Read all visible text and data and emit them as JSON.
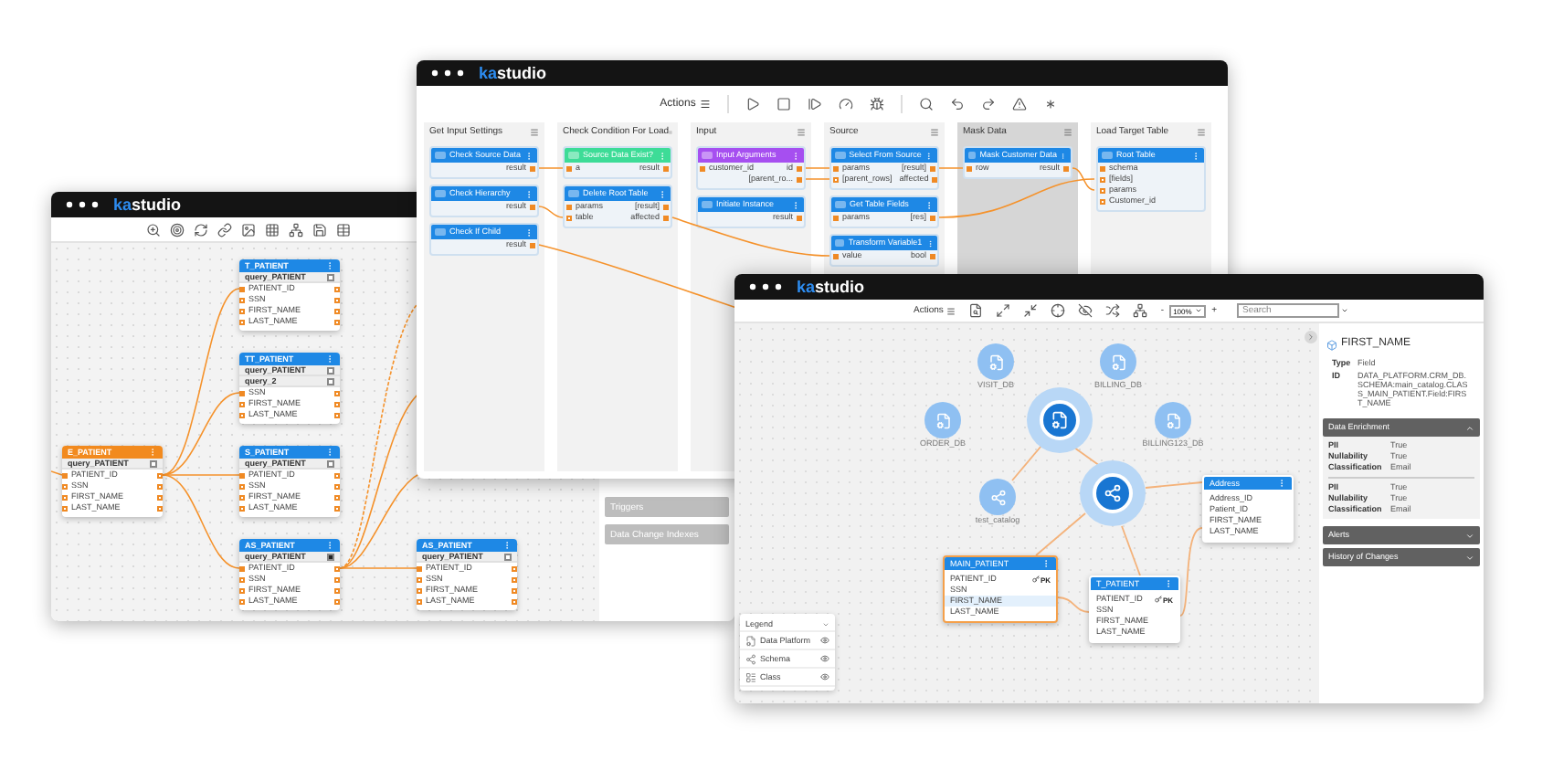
{
  "left_window": {
    "logo": {
      "accent": "ka",
      "rest": "studio"
    },
    "tables": [
      {
        "name": "T_PATIENT",
        "selected": false,
        "queries": [
          {
            "label": "query_PATIENT",
            "checked": false
          }
        ],
        "fields": [
          "PATIENT_ID",
          "SSN",
          "FIRST_NAME",
          "LAST_NAME"
        ]
      },
      {
        "name": "TT_PATIENT",
        "selected": false,
        "queries": [
          {
            "label": "query_PATIENT",
            "checked": false
          },
          {
            "label": "query_2",
            "checked": false
          }
        ],
        "fields": [
          "SSN",
          "FIRST_NAME",
          "LAST_NAME"
        ]
      },
      {
        "name": "S_PATIENT",
        "selected": false,
        "queries": [
          {
            "label": "query_PATIENT",
            "checked": false
          }
        ],
        "fields": [
          "PATIENT_ID",
          "SSN",
          "FIRST_NAME",
          "LAST_NAME"
        ]
      },
      {
        "name": "AS_PATIENT",
        "selected": false,
        "queries": [
          {
            "label": "query_PATIENT",
            "checked": true
          }
        ],
        "fields": [
          "PATIENT_ID",
          "SSN",
          "FIRST_NAME",
          "LAST_NAME"
        ]
      },
      {
        "name": "E_PATIENT",
        "selected": true,
        "queries": [
          {
            "label": "query_PATIENT",
            "checked": false
          }
        ],
        "fields": [
          "PATIENT_ID",
          "SSN",
          "FIRST_NAME",
          "LAST_NAME"
        ]
      },
      {
        "name": "AS_PATIENT",
        "selected": false,
        "queries": [
          {
            "label": "query_PATIENT",
            "checked": false
          }
        ],
        "fields": [
          "PATIENT_ID",
          "SSN",
          "FIRST_NAME",
          "LAST_NAME"
        ]
      }
    ],
    "side_panel": [
      "Triggers",
      "Data Change Indexes"
    ]
  },
  "top_window": {
    "logo": {
      "accent": "ka",
      "rest": "studio"
    },
    "actions": "Actions",
    "columns": [
      {
        "title": "Get Input Settings",
        "disabled": false,
        "nodes": [
          {
            "title": "Check Source Data",
            "color": "#1e88e5",
            "ports": [
              {
                "out": "result"
              }
            ]
          },
          {
            "title": "Check Hierarchy",
            "color": "#1e88e5",
            "ports": [
              {
                "out": "result"
              }
            ]
          },
          {
            "title": "Check If Child",
            "color": "#1e88e5",
            "ports": [
              {
                "out": "result"
              }
            ]
          }
        ]
      },
      {
        "title": "Check Condition For Load",
        "disabled": false,
        "nodes": [
          {
            "title": "Source Data Exist?",
            "color": "#3ddc97",
            "ports": [
              {
                "in": "a",
                "out": "result"
              }
            ]
          },
          {
            "title": "Delete Root Table",
            "color": "#1e88e5",
            "ports": [
              {
                "in": "params",
                "out": "[result]"
              },
              {
                "in": "table",
                "out": "affected"
              }
            ]
          }
        ]
      },
      {
        "title": "Input",
        "disabled": false,
        "nodes": [
          {
            "title": "Input Arguments",
            "color": "#a64ff0",
            "ports": [
              {
                "in": "customer_id",
                "out": "id"
              },
              {
                "out": "[parent_ro..."
              }
            ]
          },
          {
            "title": "Initiate Instance",
            "color": "#1e88e5",
            "ports": [
              {
                "out": "result"
              }
            ]
          }
        ]
      },
      {
        "title": "Source",
        "disabled": false,
        "nodes": [
          {
            "title": "Select From Source",
            "color": "#1e88e5",
            "ports": [
              {
                "in": "params",
                "out": "[result]"
              },
              {
                "in": "[parent_rows]",
                "out": "affected"
              }
            ]
          },
          {
            "title": "Get Table Fields",
            "color": "#1e88e5",
            "ports": [
              {
                "in": "params",
                "out": "[res]"
              }
            ]
          },
          {
            "title": "Transform Variable1",
            "color": "#1e88e5",
            "ports": [
              {
                "in": "value",
                "out": "bool"
              }
            ]
          }
        ]
      },
      {
        "title": "Mask Data",
        "disabled": true,
        "nodes": [
          {
            "title": "Mask Customer Data",
            "color": "#1e88e5",
            "ports": [
              {
                "in": "row",
                "out": "result"
              }
            ]
          }
        ]
      },
      {
        "title": "Load Target Table",
        "disabled": false,
        "nodes": [
          {
            "title": "Root Table",
            "color": "#1e88e5",
            "ports": [
              {
                "in": "schema"
              },
              {
                "in": "[fields]"
              },
              {
                "in": "params"
              },
              {
                "in": "Customer_id"
              }
            ]
          }
        ]
      }
    ]
  },
  "right_window": {
    "logo": {
      "accent": "ka",
      "rest": "studio"
    },
    "actions": "Actions",
    "zoom_out": "-",
    "zoom": "100%",
    "zoom_in": "+",
    "search_placeholder": "Search",
    "nodes": [
      {
        "kind": "platform",
        "label": "VISIT_DB"
      },
      {
        "kind": "platform",
        "label": "BILLING_DB"
      },
      {
        "kind": "platform",
        "label": "ORDER_DB"
      },
      {
        "kind": "platform",
        "label": "BILLING123_DB"
      },
      {
        "kind": "schema",
        "label": "test_catalog"
      },
      {
        "kind": "hub-platform"
      },
      {
        "kind": "hub-schema"
      }
    ],
    "tables": [
      {
        "name": "MAIN_PATIENT",
        "selected": true,
        "fields": [
          {
            "name": "PATIENT_ID",
            "key": "PK",
            "selected": false
          },
          {
            "name": "SSN",
            "selected": false
          },
          {
            "name": "FIRST_NAME",
            "selected": true
          },
          {
            "name": "LAST_NAME",
            "selected": false
          }
        ]
      },
      {
        "name": "T_PATIENT",
        "selected": false,
        "fields": [
          {
            "name": "PATIENT_ID",
            "key": "PK",
            "selected": false
          },
          {
            "name": "SSN",
            "selected": false
          },
          {
            "name": "FIRST_NAME",
            "selected": false
          },
          {
            "name": "LAST_NAME",
            "selected": false
          }
        ]
      },
      {
        "name": "Address",
        "selected": false,
        "fields": [
          {
            "name": "Address_ID",
            "selected": false
          },
          {
            "name": "Patient_ID",
            "selected": false
          },
          {
            "name": "FIRST_NAME",
            "selected": false
          },
          {
            "name": "LAST_NAME",
            "selected": false
          }
        ]
      }
    ],
    "legend": {
      "title": "Legend",
      "items": [
        {
          "kind": "platform",
          "label": "Data Platform"
        },
        {
          "kind": "schema",
          "label": "Schema"
        },
        {
          "kind": "class",
          "label": "Class"
        }
      ]
    },
    "details": {
      "title": "FIRST_NAME",
      "properties": [
        {
          "label": "Type",
          "value": "Field"
        },
        {
          "label": "ID",
          "value": "DATA_PLATFORM.CRM_DB.SCHEMA:main_catalog.CLASS_MAIN_PATIENT.Field:FIRST_NAME"
        }
      ],
      "sections": [
        {
          "title": "Data Enrichment",
          "expanded": true,
          "groups": [
            [
              {
                "label": "PII",
                "value": "True"
              },
              {
                "label": "Nullability",
                "value": "True"
              },
              {
                "label": "Classification",
                "value": "Email"
              }
            ],
            [
              {
                "label": "PII",
                "value": "True"
              },
              {
                "label": "Nullability",
                "value": "True"
              },
              {
                "label": "Classification",
                "value": "Email"
              }
            ]
          ]
        },
        {
          "title": "Alerts",
          "expanded": false
        },
        {
          "title": "History of Changes",
          "expanded": false
        }
      ]
    }
  }
}
